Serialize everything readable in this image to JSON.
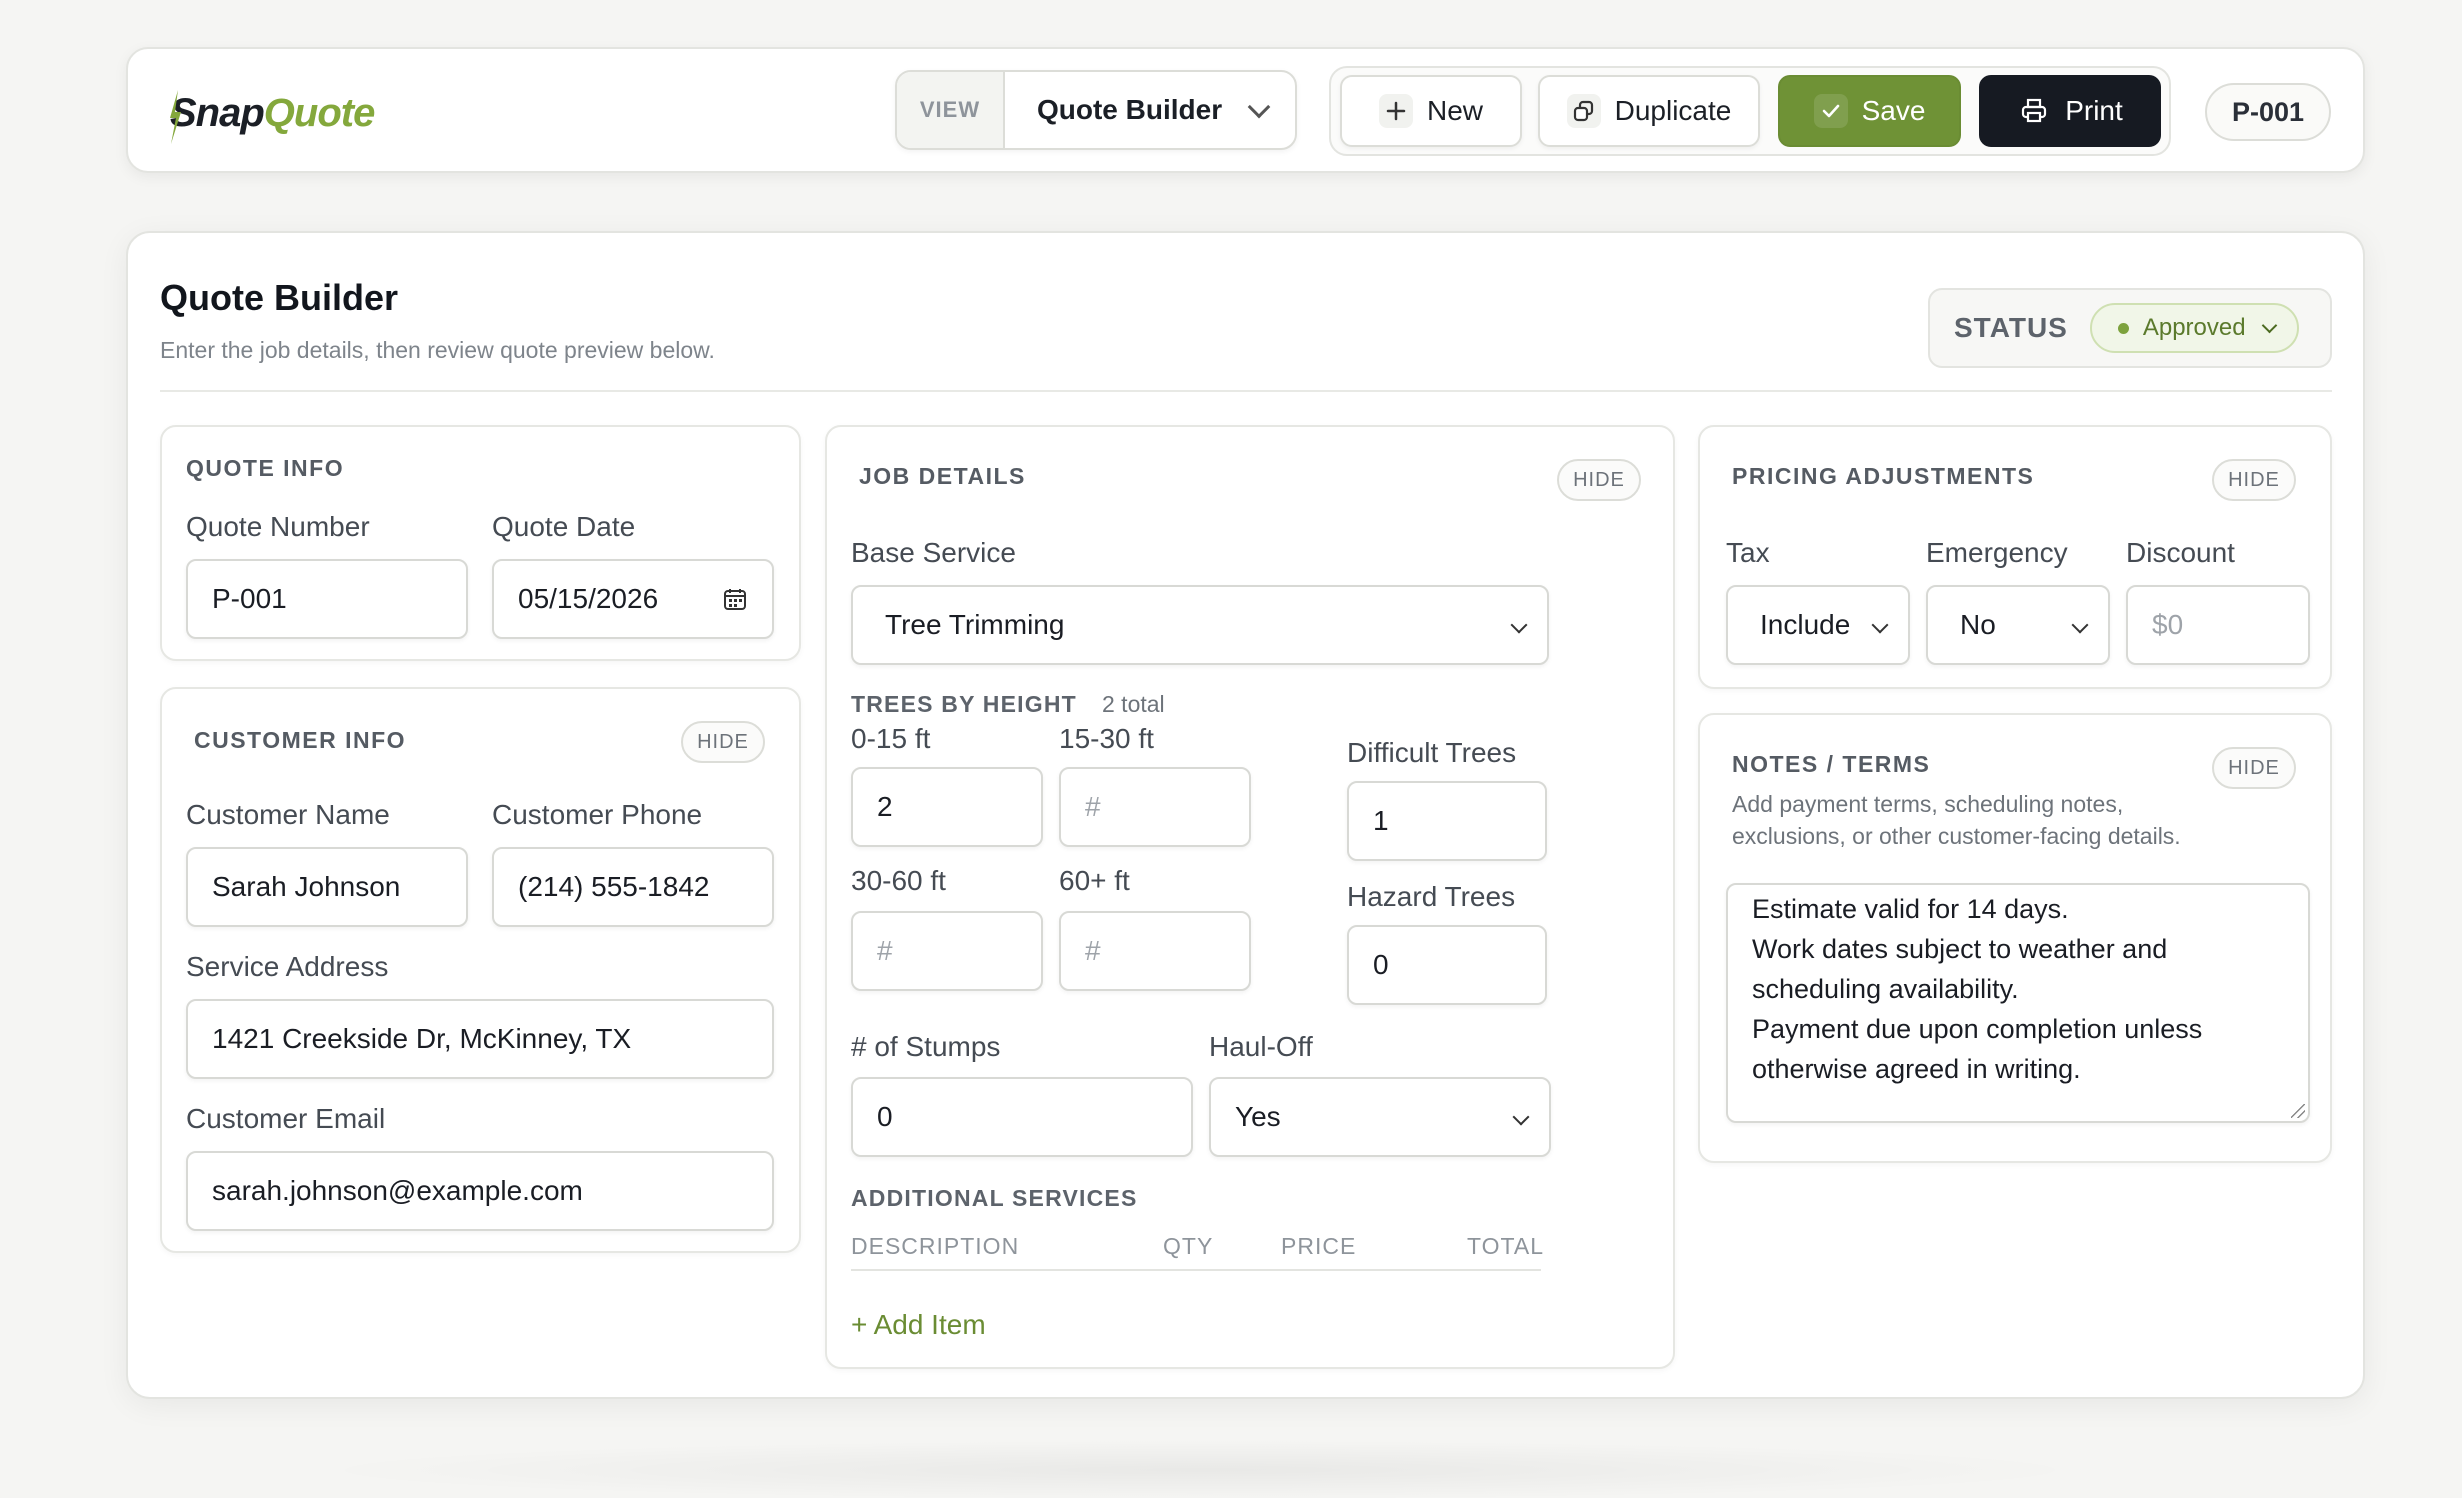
{
  "header": {
    "logo": {
      "part1": "Snap",
      "part2": "Quote"
    },
    "view_label": "VIEW",
    "view_value": "Quote Builder",
    "actions": {
      "new": "New",
      "duplicate": "Duplicate",
      "save": "Save",
      "print": "Print"
    },
    "quote_id": "P-001"
  },
  "page": {
    "title": "Quote Builder",
    "subtitle": "Enter the job details, then review quote preview below.",
    "status_label": "STATUS",
    "status_value": "Approved"
  },
  "quote_info": {
    "title": "QUOTE INFO",
    "number_label": "Quote Number",
    "number_value": "P-001",
    "date_label": "Quote Date",
    "date_value": "05/15/2026"
  },
  "customer_info": {
    "title": "CUSTOMER INFO",
    "hide": "HIDE",
    "name_label": "Customer Name",
    "name_value": "Sarah Johnson",
    "phone_label": "Customer Phone",
    "phone_value": "(214) 555-1842",
    "address_label": "Service Address",
    "address_value": "1421 Creekside Dr, McKinney, TX",
    "email_label": "Customer Email",
    "email_value": "sarah.johnson@example.com"
  },
  "job_details": {
    "title": "JOB DETAILS",
    "hide": "HIDE",
    "base_service_label": "Base Service",
    "base_service_value": "Tree Trimming",
    "trees_heading": "TREES BY HEIGHT",
    "trees_total": "2 total",
    "h0_15_label": "0-15 ft",
    "h0_15_value": "2",
    "h15_30_label": "15-30 ft",
    "h15_30_placeholder": "#",
    "h30_60_label": "30-60 ft",
    "h30_60_placeholder": "#",
    "h60_label": "60+ ft",
    "h60_placeholder": "#",
    "difficult_label": "Difficult Trees",
    "difficult_value": "1",
    "hazard_label": "Hazard Trees",
    "hazard_value": "0",
    "stumps_label": "# of Stumps",
    "stumps_value": "0",
    "haul_label": "Haul-Off",
    "haul_value": "Yes",
    "additional_heading": "ADDITIONAL SERVICES",
    "columns": [
      "DESCRIPTION",
      "QTY",
      "PRICE",
      "TOTAL"
    ],
    "add_item": "+ Add Item"
  },
  "pricing": {
    "title": "PRICING ADJUSTMENTS",
    "hide": "HIDE",
    "tax_label": "Tax",
    "tax_value": "Include",
    "emergency_label": "Emergency",
    "emergency_value": "No",
    "discount_label": "Discount",
    "discount_placeholder": "$0"
  },
  "notes": {
    "title": "NOTES / TERMS",
    "hide": "HIDE",
    "help_line1": "Add payment terms, scheduling notes,",
    "help_line2": "exclusions, or other customer-facing details.",
    "lines": [
      "Estimate valid for 14 days.",
      "Work dates subject to weather and",
      "scheduling availability.",
      "Payment due upon completion unless",
      "otherwise agreed in writing."
    ]
  },
  "colors": {
    "accent_green": "#6f9236",
    "dark": "#161a22",
    "brand_green": "#84a83c"
  }
}
